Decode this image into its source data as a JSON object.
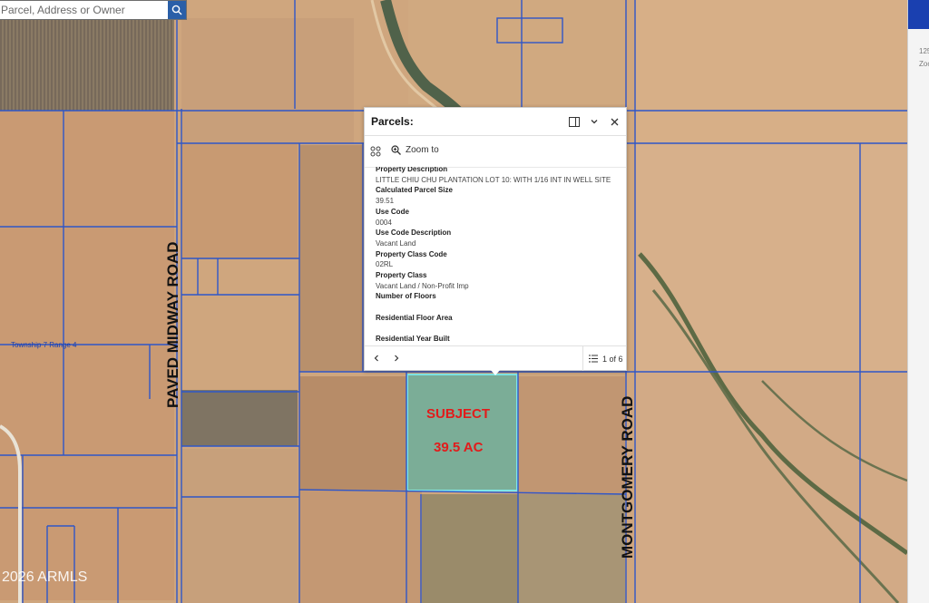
{
  "search": {
    "placeholder": "Parcel, Address or Owner"
  },
  "map_labels": {
    "road_west": "PAVED MIDWAY ROAD",
    "road_east": "MONTGOMERY ROAD",
    "subject": "SUBJECT",
    "acres": "39.5 AC",
    "township": "Township 7 Range 4",
    "watermark": "2026 ARMLS"
  },
  "right_panel": {
    "text1": "125",
    "text2": "Zoo"
  },
  "popup": {
    "title": "Parcels:",
    "zoom_label": "Zoom to",
    "fields": [
      {
        "label": "Property Description",
        "value": "LITTLE CHIU CHU PLANTATION LOT 10: WITH 1/16 INT IN WELL SITE"
      },
      {
        "label": "Calculated Parcel Size",
        "value": "39.51"
      },
      {
        "label": "Use Code",
        "value": "0004"
      },
      {
        "label": "Use Code Description",
        "value": "Vacant Land"
      },
      {
        "label": "Property Class Code",
        "value": "02RL"
      },
      {
        "label": "Property Class",
        "value": "Vacant Land / Non-Profit Imp"
      },
      {
        "label": "Number of Floors",
        "value": ""
      },
      {
        "label": "Residential Floor Area",
        "value": ""
      },
      {
        "label": "Residential Year Built",
        "value": ""
      }
    ],
    "pager": "1 of 6"
  },
  "colors": {
    "accent": "#1a40b0",
    "parcel_line": "#2f56c8",
    "subject_fill": "#43b3a8",
    "subject_text": "#e21b1b"
  }
}
